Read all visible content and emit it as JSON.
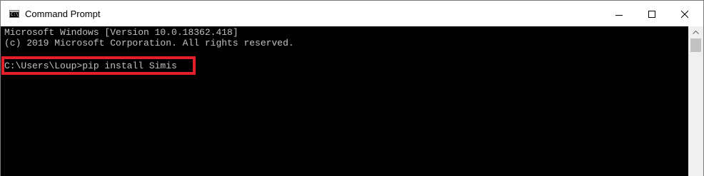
{
  "window": {
    "title": "Command Prompt",
    "icon": "cmd-app-icon",
    "icon_glyph": "C:\\",
    "controls": {
      "minimize": "minimize-icon",
      "maximize": "maximize-icon",
      "close": "close-icon"
    }
  },
  "console": {
    "lines": [
      "Microsoft Windows [Version 10.0.18362.418]",
      "(c) 2019 Microsoft Corporation. All rights reserved.",
      "C:\\Users\\Loup>pip install Simis"
    ],
    "text_color": "#c0c0c0",
    "background": "#000000",
    "highlight_color": "#e3202a"
  }
}
